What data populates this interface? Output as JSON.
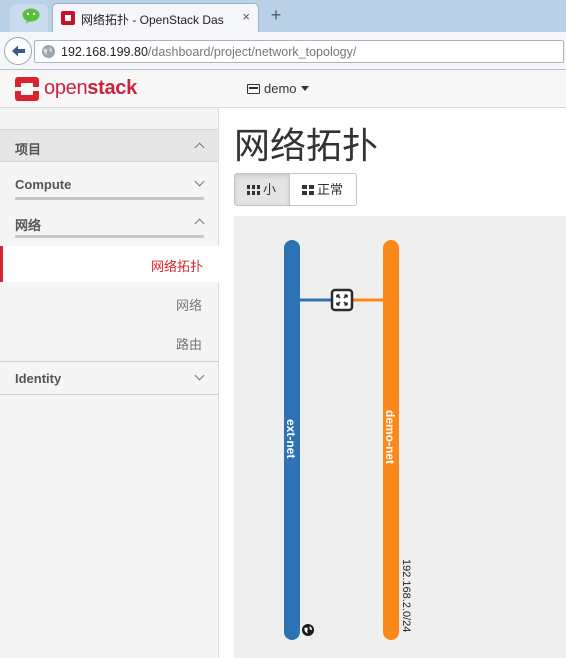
{
  "browser": {
    "tab_title": "网络拓扑 - OpenStack Das",
    "tab_close": "×",
    "new_tab": "+",
    "url_host": "192.168.199.80",
    "url_path": "/dashboard/project/network_topology/"
  },
  "header": {
    "logo_prefix": "open",
    "logo_suffix": "stack",
    "project_name": "demo"
  },
  "sidebar": {
    "project_label": "项目",
    "compute_label": "Compute",
    "network_label": "网络",
    "items": [
      {
        "label": "网络拓扑",
        "active": true
      },
      {
        "label": "网络",
        "active": false
      },
      {
        "label": "路由",
        "active": false
      }
    ],
    "identity_label": "Identity"
  },
  "main": {
    "title": "网络拓扑",
    "view_small": "小",
    "view_normal": "正常"
  },
  "topology": {
    "networks": [
      {
        "name": "ext-net",
        "color": "#2d73b4",
        "external": true
      },
      {
        "name": "demo-net",
        "color": "#fb8818",
        "cidr": "192.168.2.0/24"
      }
    ],
    "router_icon": "router-icon",
    "external_icon": "globe-icon"
  },
  "colors": {
    "accent_red": "#d9232e",
    "ext_net": "#2d73b4",
    "demo_net": "#fb8818",
    "canvas_bg": "#efefef"
  }
}
